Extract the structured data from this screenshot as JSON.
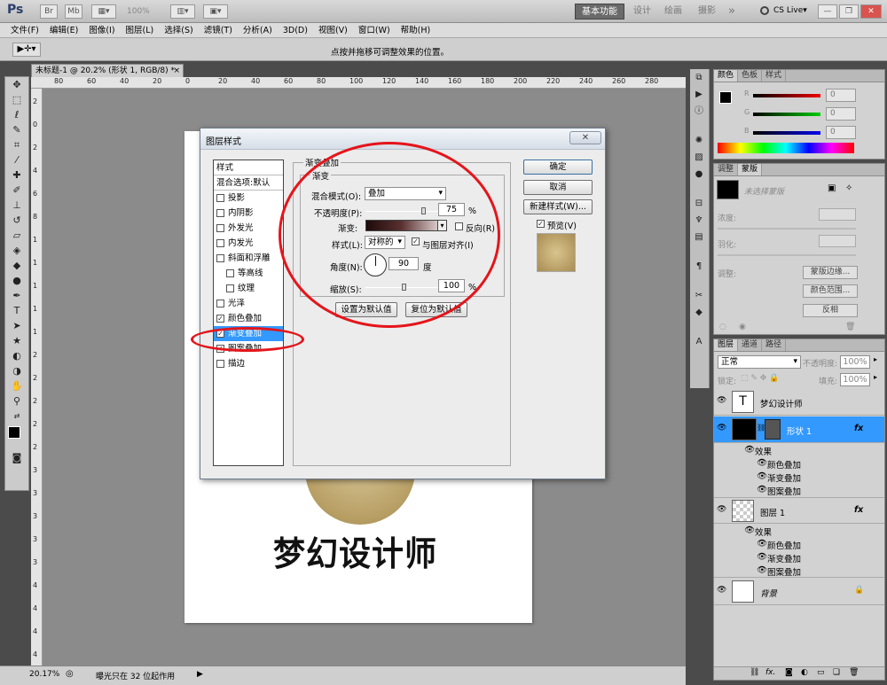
{
  "app": {
    "logo": "Ps",
    "zoom_display": "100%",
    "workspace": [
      "基本功能",
      "设计",
      "绘画",
      "摄影"
    ],
    "more": "»",
    "cs_live": "CS Live▾"
  },
  "menu": [
    "文件(F)",
    "编辑(E)",
    "图像(I)",
    "图层(L)",
    "选择(S)",
    "滤镜(T)",
    "分析(A)",
    "3D(D)",
    "视图(V)",
    "窗口(W)",
    "帮助(H)"
  ],
  "options_bar": {
    "hint": "点按并拖移可调整效果的位置。"
  },
  "document": {
    "tab_title": "未标题-1 @ 20.2% (形状 1, RGB/8) *",
    "tab_close": "×",
    "ruler_h": [
      "80",
      "60",
      "40",
      "20",
      "0",
      "20",
      "40",
      "60",
      "80",
      "100",
      "120",
      "140",
      "160",
      "180",
      "200",
      "220",
      "240",
      "260",
      "280"
    ],
    "ruler_v": [
      "2",
      "0",
      "2",
      "4",
      "6",
      "8",
      "1",
      "1",
      "1",
      "1",
      "1",
      "2",
      "2",
      "2",
      "2",
      "2",
      "3",
      "3",
      "3",
      "3",
      "3",
      "4",
      "4",
      "4",
      "4"
    ],
    "canvas_text": "梦幻设计师"
  },
  "status": {
    "zoom": "20.17%",
    "info": "曝光只在 32 位起作用"
  },
  "dialog": {
    "title": "图层样式",
    "close": "✕",
    "styles_header": "样式",
    "blend_default": "混合选项:默认",
    "styles": [
      {
        "label": "投影",
        "checked": ""
      },
      {
        "label": "内阴影",
        "checked": ""
      },
      {
        "label": "外发光",
        "checked": ""
      },
      {
        "label": "内发光",
        "checked": ""
      },
      {
        "label": "斜面和浮雕",
        "checked": ""
      },
      {
        "label": "等高线",
        "checked": ""
      },
      {
        "label": "纹理",
        "checked": ""
      },
      {
        "label": "光泽",
        "checked": ""
      },
      {
        "label": "颜色叠加",
        "checked": "✓"
      },
      {
        "label": "渐变叠加",
        "checked": "✓"
      },
      {
        "label": "图案叠加",
        "checked": "✓"
      },
      {
        "label": "描边",
        "checked": ""
      }
    ],
    "section": "渐变叠加",
    "subsection": "渐变",
    "blend_mode_label": "混合模式(O):",
    "blend_mode": "叠加",
    "opacity_label": "不透明度(P):",
    "opacity": "75",
    "opacity_unit": "%",
    "opacity_fraction": 0.75,
    "gradient_label": "渐变:",
    "reverse_label": "反向(R)",
    "style_label": "样式(L):",
    "style_value": "对称的",
    "align_label": "与图层对齐(I)",
    "angle_label": "角度(N):",
    "angle": "90",
    "angle_unit": "度",
    "scale_label": "缩放(S):",
    "scale": "100",
    "scale_unit": "%",
    "scale_fraction": 0.5,
    "set_default": "设置为默认值",
    "reset_default": "复位为默认值",
    "ok": "确定",
    "cancel": "取消",
    "new_style": "新建样式(W)...",
    "preview_label": "预览(V)"
  },
  "panels": {
    "color_tabs": [
      "颜色",
      "色板",
      "样式"
    ],
    "rgb": [
      {
        "label": "R",
        "value": "0"
      },
      {
        "label": "G",
        "value": "0"
      },
      {
        "label": "B",
        "value": "0"
      }
    ],
    "adjust_tabs": [
      "调整",
      "蒙版"
    ],
    "mask_hint": "未选择蒙版",
    "mask_density": "浓度:",
    "mask_feather": "羽化:",
    "mask_refine": "调整:",
    "mask_edge": "蒙版边缘...",
    "mask_range": "颜色范围...",
    "mask_invert": "反相",
    "layers_tabs": [
      "图层",
      "通道",
      "路径"
    ],
    "blend_mode": "正常",
    "opacity_label": "不透明度:",
    "opacity": "100%",
    "lock_label": "锁定:",
    "fill_label": "填充:",
    "fill": "100%",
    "layers": [
      {
        "name": "梦幻设计师",
        "thumb": "T"
      },
      {
        "name": "形状 1",
        "fx": "fx"
      },
      {
        "name": "图层 1",
        "fx": "fx"
      },
      {
        "name": "背景"
      }
    ],
    "effects_label": "效果",
    "effects": [
      "颜色叠加",
      "渐变叠加",
      "图案叠加"
    ]
  },
  "colors": {
    "annotation": "#e4151b",
    "selection": "#3399ff",
    "layer_selected": "#3399ff"
  }
}
